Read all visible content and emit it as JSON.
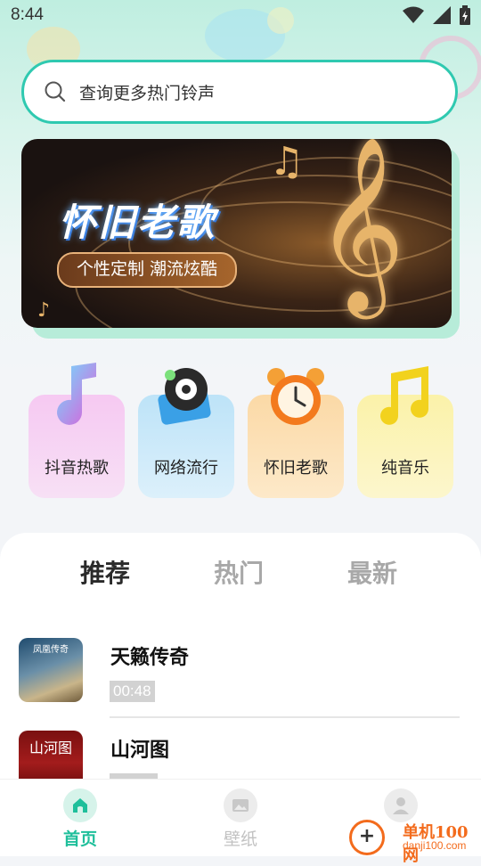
{
  "status_bar": {
    "time": "8:44"
  },
  "search": {
    "placeholder": "查询更多热门铃声"
  },
  "banner": {
    "title": "怀旧老歌",
    "tagline": "个性定制 潮流炫酷"
  },
  "categories": [
    {
      "label": "抖音热歌",
      "icon": "music-note-3d-icon"
    },
    {
      "label": "网络流行",
      "icon": "speaker-icon"
    },
    {
      "label": "怀旧老歌",
      "icon": "alarm-clock-icon"
    },
    {
      "label": "纯音乐",
      "icon": "double-note-icon"
    }
  ],
  "tabs": [
    {
      "label": "推荐",
      "active": true
    },
    {
      "label": "热门",
      "active": false
    },
    {
      "label": "最新",
      "active": false
    }
  ],
  "songs": [
    {
      "title": "天籁传奇",
      "duration": "00:48",
      "cover_text": "凤凰传奇"
    },
    {
      "title": "山河图",
      "duration": "",
      "cover_text": "山河图"
    }
  ],
  "bottom_nav": [
    {
      "label": "首页",
      "active": true
    },
    {
      "label": "壁纸",
      "active": false
    },
    {
      "label": "",
      "active": false
    }
  ],
  "watermark": {
    "name": "单机100网",
    "url": "danji100.com"
  },
  "colors": {
    "accent": "#1fbf9b",
    "search_border": "#2fc9b0"
  }
}
